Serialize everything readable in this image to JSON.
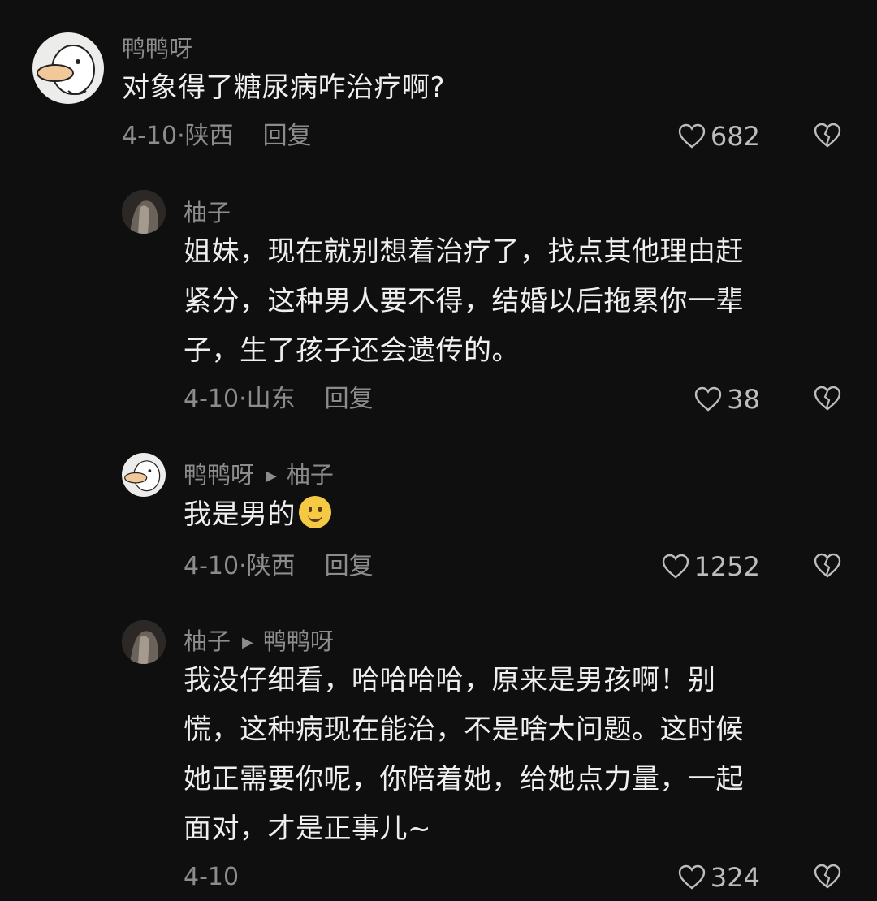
{
  "comments": [
    {
      "author": "鸭鸭呀",
      "reply_to": "",
      "lines": [
        "对象得了糖尿病咋治疗啊?"
      ],
      "meta": "4-10·陕西",
      "reply_label": "回复",
      "likes": "682"
    },
    {
      "author": "柚子",
      "reply_to": "",
      "lines": [
        "姐妹，现在就别想着治疗了，找点其他理由赶",
        "紧分，这种男人要不得，结婚以后拖累你一辈",
        "子，生了孩子还会遗传的。"
      ],
      "meta": "4-10·山东",
      "reply_label": "回复",
      "likes": "38"
    },
    {
      "author": "鸭鸭呀",
      "reply_to": "柚子",
      "lines": [
        "我是男的"
      ],
      "emoji": "smile-emoji",
      "meta": "4-10·陕西",
      "reply_label": "回复",
      "likes": "1252"
    },
    {
      "author": "柚子",
      "reply_to": "鸭鸭呀",
      "lines": [
        "我没仔细看，哈哈哈哈，原来是男孩啊！别",
        "慌，这种病现在能治，不是啥大问题。这时候",
        "她正需要你呢，你陪着她，给她点力量，一起",
        "面对，才是正事儿~"
      ],
      "meta": "4-10",
      "likes": "324"
    }
  ],
  "icons": {
    "like": "heart-outline-icon",
    "dislike": "broken-heart-icon",
    "reply_arrow": "triangle-right-icon"
  },
  "colors": {
    "background": "#0f0f10",
    "text": "#efefef",
    "muted": "#8c8c8c"
  }
}
